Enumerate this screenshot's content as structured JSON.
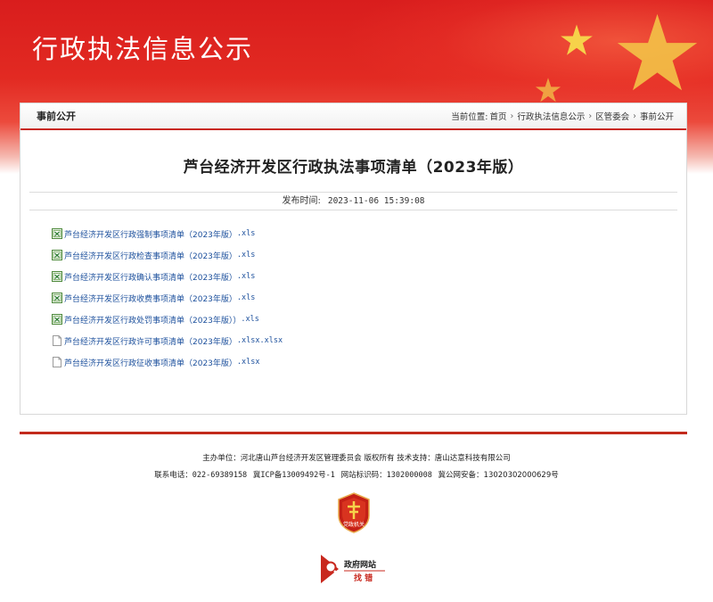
{
  "banner": {
    "title": "行政执法信息公示"
  },
  "section": {
    "label": "事前公开",
    "breadcrumb_prefix": "当前位置:",
    "breadcrumb": [
      "首页",
      "行政执法信息公示",
      "区管委会",
      "事前公开"
    ]
  },
  "article": {
    "title": "芦台经济开发区行政执法事项清单（2023年版）",
    "publish_label": "发布时间:",
    "publish_time": "2023-11-06 15:39:08"
  },
  "attachments": [
    {
      "name": "芦台经济开发区行政强制事项清单（2023年版）",
      "ext": ".xls",
      "icon": "excel-file-icon"
    },
    {
      "name": "芦台经济开发区行政检查事项清单（2023年版）",
      "ext": ".xls",
      "icon": "excel-file-icon"
    },
    {
      "name": "芦台经济开发区行政确认事项清单（2023年版）",
      "ext": ".xls",
      "icon": "excel-file-icon"
    },
    {
      "name": "芦台经济开发区行政收费事项清单（2023年版）",
      "ext": ".xls",
      "icon": "excel-file-icon"
    },
    {
      "name": "芦台经济开发区行政处罚事项清单（2023年版））",
      "ext": ".xls",
      "icon": "excel-file-icon"
    },
    {
      "name": "芦台经济开发区行政许可事项清单（2023年版）",
      "ext": ".xlsx.xlsx",
      "icon": "blank-file-icon"
    },
    {
      "name": "芦台经济开发区行政征收事项清单（2023年版）",
      "ext": ".xlsx",
      "icon": "blank-file-icon"
    }
  ],
  "footer": {
    "line1": "主办单位：河北唐山芦台经济开发区管理委员会 版权所有 技术支持：唐山达意科技有限公司",
    "phone_label": "联系电话：",
    "phone": "022-69389158",
    "icp": "冀ICP备13009492号-1",
    "site_id_label": "网站标识码：",
    "site_id": "1302000008",
    "police": "冀公网安备：13020302000629号",
    "emblem_text": "党政机关",
    "zhaocuo_line1": "政府网站",
    "zhaocuo_line2": "找 错"
  },
  "colors": {
    "brand_red": "#c8281e",
    "link_blue": "#1b4f9c",
    "banner_red": "#e22a22",
    "star_gold": "#f6d24a"
  }
}
